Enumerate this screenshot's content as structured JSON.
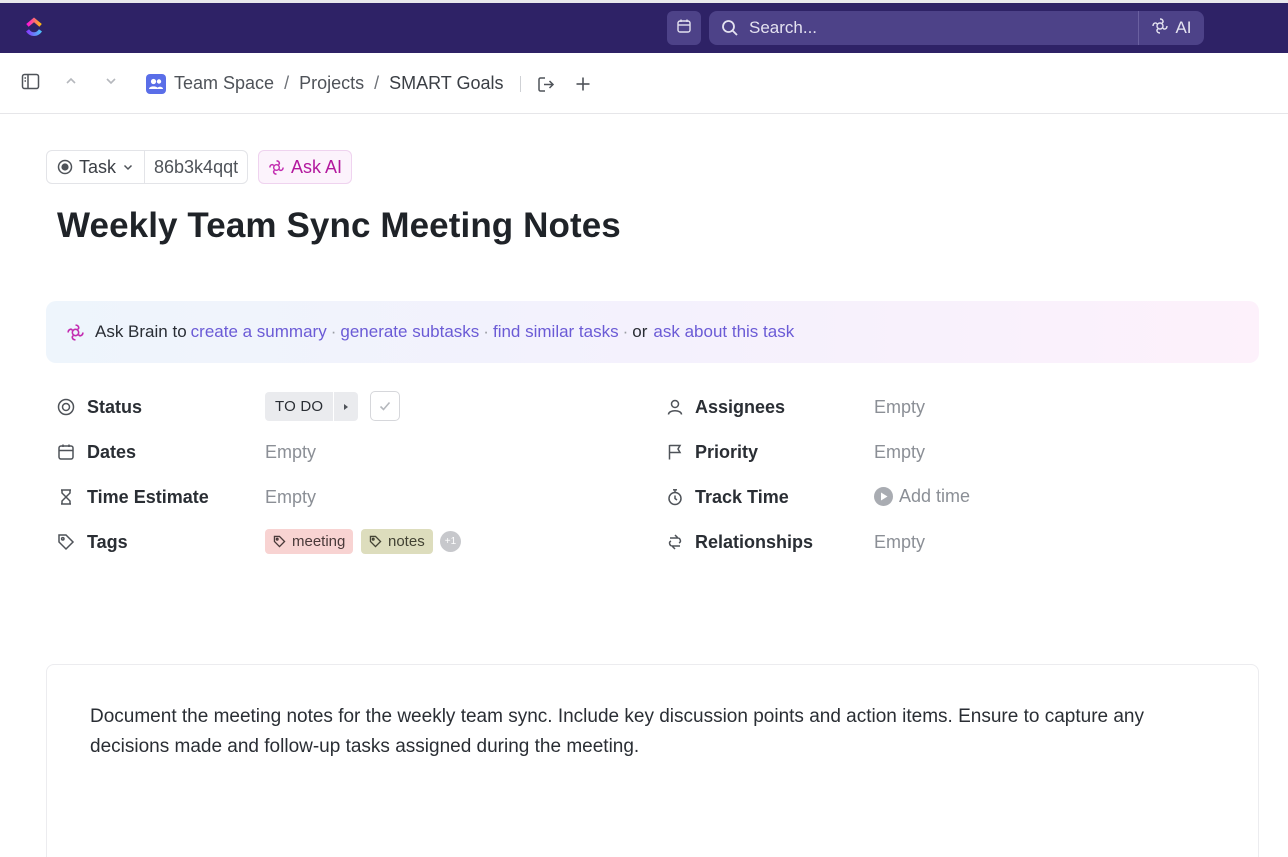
{
  "topbar": {
    "search_placeholder": "Search...",
    "ai_label": "AI",
    "colors": {
      "background": "#2e2266",
      "search_bg": "#4d4288"
    },
    "icons": [
      "clickup-logo-icon",
      "calendar-icon",
      "search-icon",
      "ai-brain-icon"
    ]
  },
  "breadcrumb": {
    "items": [
      "Team Space",
      "Projects",
      "SMART Goals"
    ],
    "separator": "/",
    "icons": [
      "sidebar-toggle-icon",
      "chevron-up-icon",
      "chevron-down-icon",
      "team-space-icon",
      "share-icon",
      "plus-icon"
    ]
  },
  "task": {
    "type_label": "Task",
    "id": "86b3k4qqt",
    "ask_ai_label": "Ask AI",
    "title": "Weekly Team Sync Meeting Notes"
  },
  "brain": {
    "prefix": "Ask Brain to",
    "links": [
      "create a summary",
      "generate subtasks",
      "find similar tasks",
      "ask about this task"
    ],
    "separator": "·",
    "or_word": "or"
  },
  "fields": {
    "status": {
      "label": "Status",
      "value": "TO DO"
    },
    "dates": {
      "label": "Dates",
      "value": "Empty"
    },
    "time_estimate": {
      "label": "Time Estimate",
      "value": "Empty"
    },
    "tags": {
      "label": "Tags",
      "items": [
        "meeting",
        "notes"
      ],
      "more": "+1"
    },
    "assignees": {
      "label": "Assignees",
      "value": "Empty"
    },
    "priority": {
      "label": "Priority",
      "value": "Empty"
    },
    "track_time": {
      "label": "Track Time",
      "value": "Add time"
    },
    "relationships": {
      "label": "Relationships",
      "value": "Empty"
    }
  },
  "tag_colors": {
    "meeting": "#f8d3d2",
    "notes": "#ddddbd"
  },
  "description": "Document the meeting notes for the weekly team sync. Include key discussion points and action items. Ensure to capture any decisions made and follow-up tasks assigned during the meeting."
}
